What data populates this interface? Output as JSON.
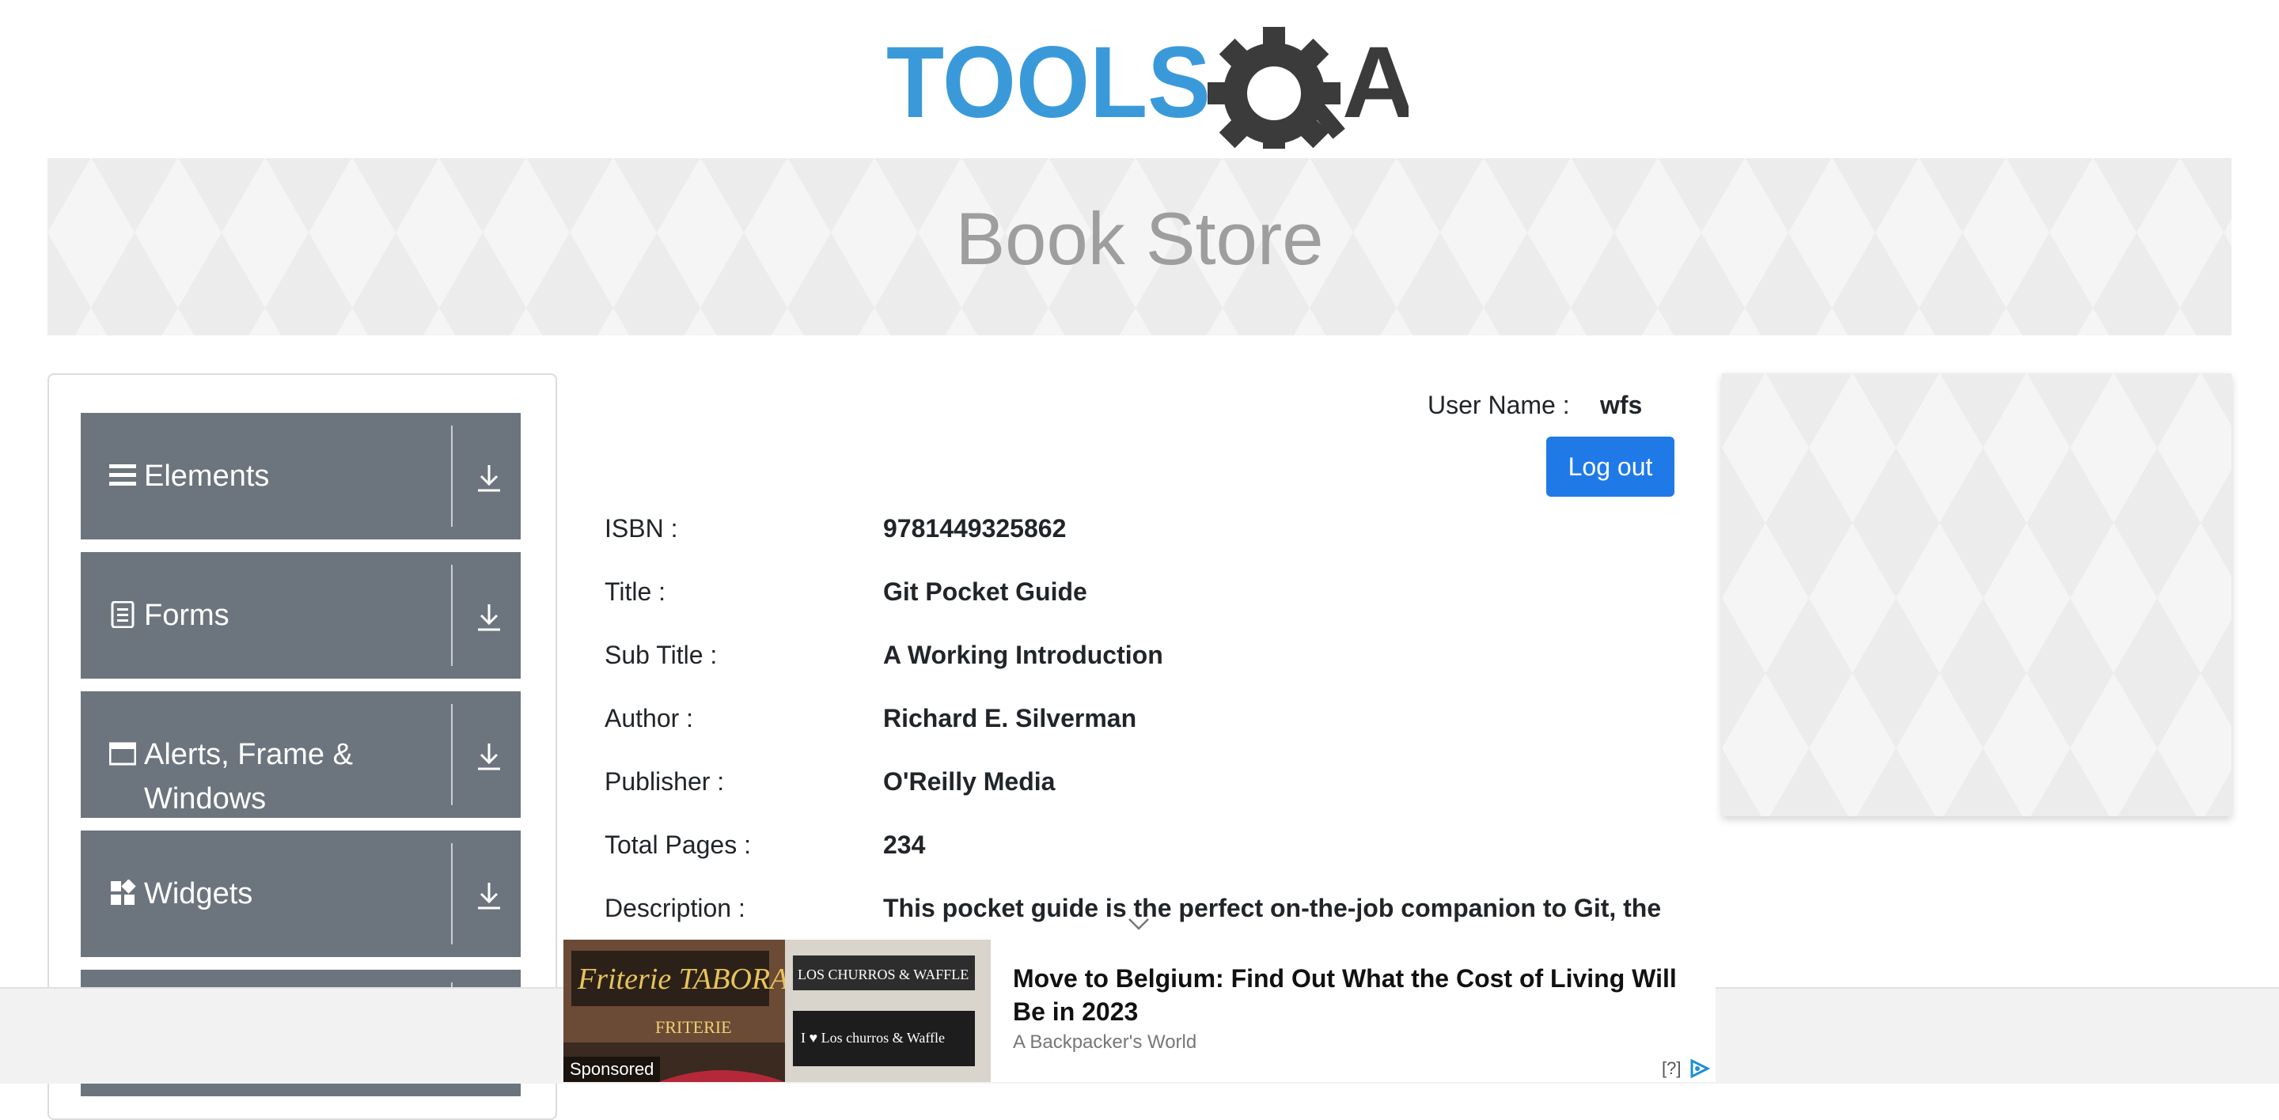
{
  "logo": {
    "text_blue": "TOOLS",
    "text_dark": "A",
    "brand_blue": "#3a9ad9",
    "brand_dark": "#3b3b3b"
  },
  "banner": {
    "title": "Book Store"
  },
  "sidebar": {
    "items": [
      {
        "label": "Elements",
        "icon": "list-icon"
      },
      {
        "label": "Forms",
        "icon": "document-icon"
      },
      {
        "label": "Alerts, Frame &",
        "label_line2": "Windows",
        "icon": "window-icon"
      },
      {
        "label": "Widgets",
        "icon": "widgets-icon"
      }
    ]
  },
  "user": {
    "label": "User Name :",
    "value": "wfs"
  },
  "logout_label": "Log out",
  "book": {
    "fields": [
      {
        "label": "ISBN :",
        "value": "9781449325862"
      },
      {
        "label": "Title :",
        "value": "Git Pocket Guide"
      },
      {
        "label": "Sub Title :",
        "value": "A Working Introduction"
      },
      {
        "label": "Author :",
        "value": "Richard E. Silverman"
      },
      {
        "label": "Publisher :",
        "value": "O'Reilly Media"
      },
      {
        "label": "Total Pages :",
        "value": "234"
      },
      {
        "label": "Description :",
        "value": "This pocket guide is the perfect on-the-job companion to Git, the"
      }
    ]
  },
  "ad": {
    "sponsored": "Sponsored",
    "image_sign_1": "Friterie TABORA",
    "image_sign_2": "LOS CHURROS & WAFFLE",
    "image_sign_3": "FRITERIE",
    "image_sign_4": "I ♥ Los churros & Waffle",
    "headline": "Move to Belgium: Find Out What the Cost of Living Will Be in 2023",
    "source": "A Backpacker's World",
    "help": "[?]"
  },
  "colors": {
    "primary_button": "#1f7ae8",
    "sidebar_group": "#6c757d"
  }
}
